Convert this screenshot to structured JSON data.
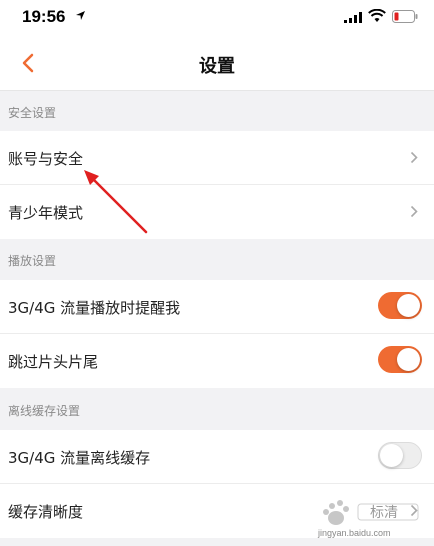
{
  "status_bar": {
    "time": "19:56"
  },
  "nav": {
    "title": "设置"
  },
  "sections": [
    {
      "header": "安全设置",
      "rows": [
        {
          "label": "账号与安全"
        },
        {
          "label": "青少年模式"
        }
      ]
    },
    {
      "header": "播放设置",
      "rows": [
        {
          "label": "3G/4G 流量播放时提醒我",
          "toggle": "on"
        },
        {
          "label": "跳过片头片尾",
          "toggle": "on"
        }
      ]
    },
    {
      "header": "离线缓存设置",
      "rows": [
        {
          "label": "3G/4G 流量离线缓存",
          "toggle": "off"
        },
        {
          "label": "缓存清晰度",
          "value": "标清"
        }
      ]
    }
  ],
  "watermark": {
    "url": "jingyan.baidu.com"
  },
  "colors": {
    "accent": "#ef6b32",
    "annotation": "#e02020"
  }
}
